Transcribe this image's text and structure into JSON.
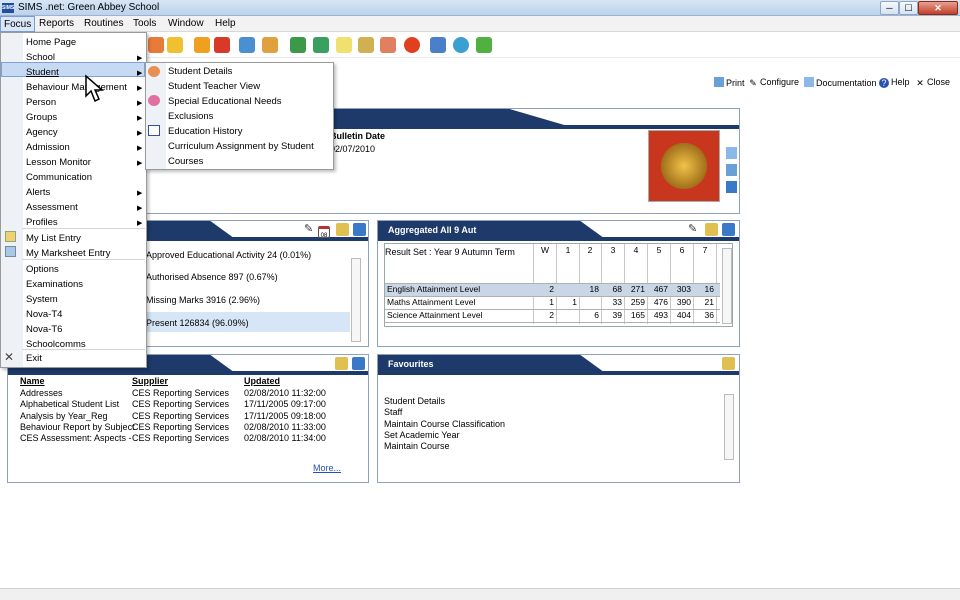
{
  "window": {
    "title": "SIMS .net: Green Abbey School",
    "app_icon": "SIMS",
    "min": "─",
    "max": "☐",
    "close": "✕"
  },
  "menubar": [
    "Focus",
    "Reports",
    "Routines",
    "Tools",
    "Window",
    "Help"
  ],
  "actions": {
    "print": "Print",
    "configure": "Configure",
    "documentation": "Documentation",
    "help": "Help",
    "close": "Close"
  },
  "bulletin": {
    "date_label": "Bulletin Date",
    "date_value": "02/07/2010"
  },
  "attendance": {
    "items": [
      "Approved Educational Activity 24 (0.01%)",
      "Authorised Absence 897 (0.67%)",
      "Missing Marks 3916 (2.96%)",
      "Present 126834 (96.09%)"
    ],
    "calendar_badge": "08"
  },
  "aggregated": {
    "title": "Aggregated All 9 Aut",
    "result_set": "Result Set : Year 9 Autumn Term",
    "columns": [
      "W",
      "1",
      "2",
      "3",
      "4",
      "5",
      "6",
      "7"
    ],
    "rows": [
      {
        "label": "English Attainment Level",
        "values": [
          "2",
          "",
          "18",
          "68",
          "271",
          "467",
          "303",
          "16"
        ]
      },
      {
        "label": "Maths Attainment Level",
        "values": [
          "1",
          "1",
          "",
          "33",
          "259",
          "476",
          "390",
          "21"
        ]
      },
      {
        "label": "Science Attainment Level",
        "values": [
          "2",
          "",
          "6",
          "39",
          "165",
          "493",
          "404",
          "36"
        ]
      }
    ]
  },
  "reports": {
    "headers": [
      "Name",
      "Supplier",
      "Updated"
    ],
    "rows": [
      [
        "Addresses",
        "CES Reporting Services",
        "02/08/2010 11:32:00"
      ],
      [
        "Alphabetical Student List",
        "CES Reporting Services",
        "17/11/2005 09:17:00"
      ],
      [
        "Analysis by Year_Reg",
        "CES Reporting Services",
        "17/11/2005 09:18:00"
      ],
      [
        "Behaviour Report by Subject",
        "CES Reporting Services",
        "02/08/2010 11:33:00"
      ],
      [
        "CES Assessment: Aspects -",
        "CES Reporting Services",
        "02/08/2010 11:34:00"
      ]
    ],
    "more": "More..."
  },
  "favourites": {
    "title": "Favourites",
    "items": [
      "Student Details",
      "Staff",
      "Maintain Course Classification",
      "Set Academic Year",
      "Maintain Course"
    ]
  },
  "focus_menu": {
    "items": [
      {
        "label": "Home Page",
        "sub": false
      },
      {
        "label": "School",
        "sub": true
      },
      {
        "label": "Student",
        "sub": true
      },
      {
        "label": "Behaviour Management",
        "sub": true
      },
      {
        "label": "Person",
        "sub": true
      },
      {
        "label": "Groups",
        "sub": true
      },
      {
        "label": "Agency",
        "sub": true
      },
      {
        "label": "Admission",
        "sub": true
      },
      {
        "label": "Lesson Monitor",
        "sub": true
      },
      {
        "label": "Communication",
        "sub": false
      },
      {
        "label": "Alerts",
        "sub": true
      },
      {
        "label": "Assessment",
        "sub": true
      },
      {
        "label": "Profiles",
        "sub": true
      },
      {
        "label": "My List Entry",
        "sub": false
      },
      {
        "label": "My Marksheet Entry",
        "sub": false
      },
      {
        "label": "Options",
        "sub": false
      },
      {
        "label": "Examinations",
        "sub": false
      },
      {
        "label": "System",
        "sub": false
      },
      {
        "label": "Nova-T4",
        "sub": false
      },
      {
        "label": "Nova-T6",
        "sub": false
      },
      {
        "label": "Schoolcomms",
        "sub": false
      },
      {
        "label": "Exit",
        "sub": false
      }
    ]
  },
  "student_menu": {
    "items": [
      "Student Details",
      "Student Teacher View",
      "Special Educational Needs",
      "Exclusions",
      "Education History",
      "Curriculum Assignment by Student",
      "Courses"
    ]
  },
  "colors": {
    "panel_header": "#1d3a6a",
    "menu_highlight": "#c7daf3"
  }
}
